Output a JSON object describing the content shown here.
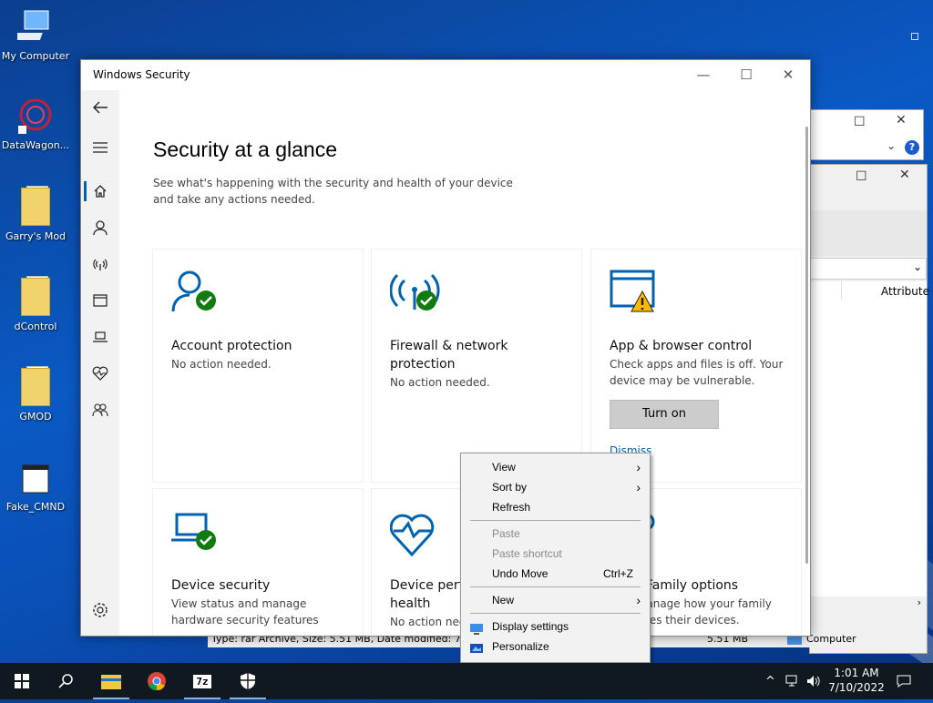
{
  "desktop": {
    "icons": [
      {
        "label": "My Computer",
        "icon": "computer-icon"
      },
      {
        "label": "DataWagon...",
        "icon": "datawagon-icon"
      },
      {
        "label": "Garry's Mod",
        "icon": "folder-icon"
      },
      {
        "label": "dControl",
        "icon": "folder-icon"
      },
      {
        "label": "GMOD",
        "icon": "folder-icon"
      },
      {
        "label": "Fake_CMND",
        "icon": "window-icon"
      }
    ]
  },
  "background_windows": {
    "column_header": "Attribute",
    "status_text": "Type: rar Archive, Size: 5.51 MB, Date modified: 7/10/...",
    "status_size": "5.51 MB",
    "status_location": "Computer"
  },
  "window": {
    "title": "Windows Security",
    "heading": "Security at a glance",
    "subheading": "See what's happening with the security and health of your device and take any actions needed.",
    "cards": [
      {
        "title": "Account protection",
        "desc": "No action needed.",
        "status": "ok"
      },
      {
        "title": "Firewall & network protection",
        "desc": "No action needed.",
        "status": "ok"
      },
      {
        "title": "App & browser control",
        "desc": "Check apps and files is off. Your device may be vulnerable.",
        "status": "warning",
        "button": "Turn on",
        "link": "Dismiss"
      },
      {
        "title": "Device security",
        "desc": "View status and manage hardware security features",
        "status": "ok"
      },
      {
        "title": "Device performance & health",
        "desc": "No action needed.",
        "status": "none"
      },
      {
        "title": "Family options",
        "desc": "Manage how your family uses their devices.",
        "status": "none"
      }
    ]
  },
  "context_menu": {
    "items": [
      {
        "label": "View",
        "submenu": true
      },
      {
        "label": "Sort by",
        "submenu": true
      },
      {
        "label": "Refresh"
      },
      {
        "label": "Paste",
        "disabled": true
      },
      {
        "label": "Paste shortcut",
        "disabled": true
      },
      {
        "label": "Undo Move",
        "shortcut": "Ctrl+Z"
      },
      {
        "label": "New",
        "submenu": true
      },
      {
        "label": "Display settings"
      },
      {
        "label": "Personalize"
      }
    ]
  },
  "taskbar": {
    "apps": [
      "start-icon",
      "search-icon",
      "file-explorer-icon",
      "chrome-icon",
      "7zip-icon",
      "windows-security-icon"
    ],
    "time": "1:01 AM",
    "date": "7/10/2022"
  },
  "colors": {
    "accent": "#0063b1",
    "ok": "#107c10",
    "warning": "#ffb900"
  }
}
